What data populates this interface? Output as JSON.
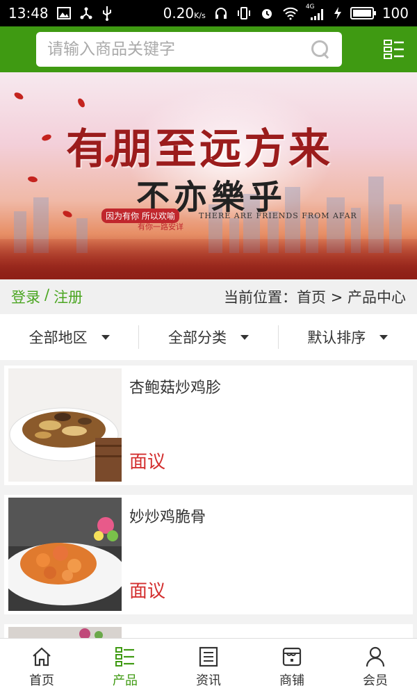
{
  "status_bar": {
    "time": "13:48",
    "network_speed": "0.20",
    "speed_unit": "K/s",
    "network_type": "4G",
    "battery": "100",
    "battery_level": 1.0
  },
  "header": {
    "search_placeholder": "请输入商品关键字",
    "brand_color": "#3f9a12"
  },
  "banner": {
    "title": "有朋至远方来",
    "subtitle": "不亦樂乎",
    "tag": "因为有你 所以欢喻",
    "english": "THERE ARE FRIENDS FROM AFAR",
    "note": "有你一路安详"
  },
  "breadcrumb": {
    "login": "登录",
    "separator": "/",
    "register": "注册",
    "location_label": "当前位置：",
    "home": "首页",
    "arrow": ">",
    "current": "产品中心"
  },
  "filters": [
    {
      "label": "全部地区"
    },
    {
      "label": "全部分类"
    },
    {
      "label": "默认排序"
    }
  ],
  "products": [
    {
      "name": "杏鲍菇炒鸡胗",
      "price": "面议"
    },
    {
      "name": "妙炒鸡脆骨",
      "price": "面议"
    }
  ],
  "bottom_nav": [
    {
      "label": "首页",
      "icon": "home-icon",
      "active": false
    },
    {
      "label": "产品",
      "icon": "product-list-icon",
      "active": true
    },
    {
      "label": "资讯",
      "icon": "news-icon",
      "active": false
    },
    {
      "label": "商铺",
      "icon": "shop-icon",
      "active": false
    },
    {
      "label": "会员",
      "icon": "member-icon",
      "active": false
    }
  ],
  "colors": {
    "accent_green": "#3f9a12",
    "login_green": "#4aa520",
    "price_red": "#d32f2f"
  }
}
